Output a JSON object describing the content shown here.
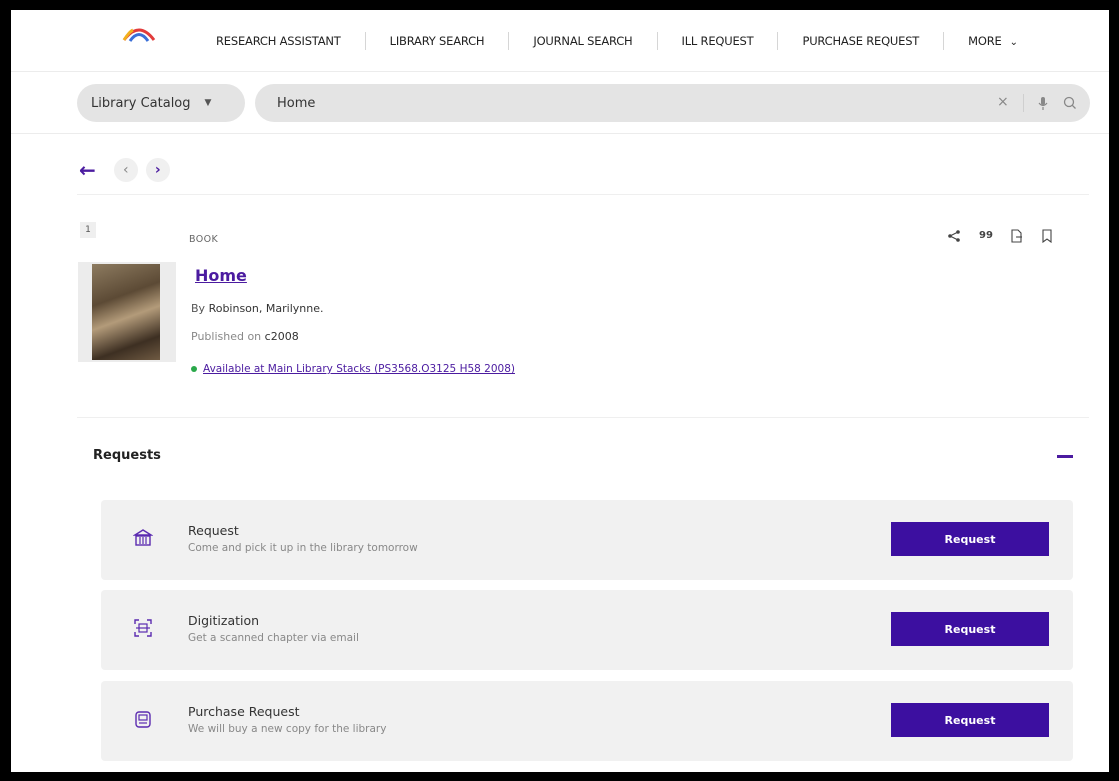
{
  "nav": {
    "items": [
      "RESEARCH ASSISTANT",
      "LIBRARY SEARCH",
      "JOURNAL SEARCH",
      "ILL REQUEST",
      "PURCHASE REQUEST",
      "MORE"
    ]
  },
  "search": {
    "scope": "Library Catalog",
    "query": "Home"
  },
  "result": {
    "number": "1",
    "type": "BOOK",
    "title": "Home",
    "by_label": "By",
    "author": "Robinson, Marilynne.",
    "published_label": "Published on",
    "published": "c2008",
    "availability": "Available at Main Library Stacks (PS3568.O3125 H58 2008)",
    "cite_label": "99"
  },
  "requests": {
    "heading": "Requests",
    "items": [
      {
        "title": "Request",
        "subtitle": "Come and pick it up in the library tomorrow",
        "button": "Request",
        "icon": "library-building-icon"
      },
      {
        "title": "Digitization",
        "subtitle": "Get a scanned chapter via email",
        "button": "Request",
        "icon": "scan-icon"
      },
      {
        "title": "Purchase Request",
        "subtitle": "We will buy a new copy for the library",
        "button": "Request",
        "icon": "purchase-icon"
      }
    ]
  },
  "colors": {
    "accent": "#4b1ba0",
    "button": "#3c0fa0",
    "available": "#2aa84a"
  }
}
